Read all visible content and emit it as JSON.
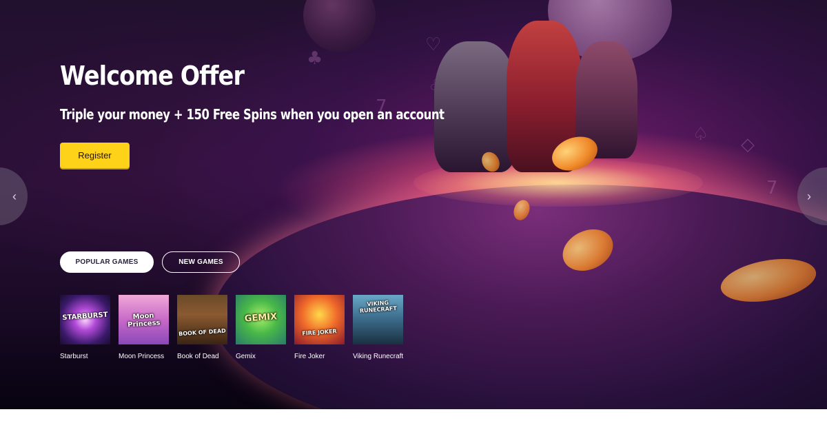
{
  "hero": {
    "title": "Welcome Offer",
    "subtitle": "Triple your money + 150 Free Spins when you open an account",
    "register_label": "Register",
    "carousel_prev_icon": "chevron-left-icon",
    "carousel_next_icon": "chevron-right-icon"
  },
  "tabs": [
    {
      "label": "POPULAR GAMES",
      "active": true
    },
    {
      "label": "NEW GAMES",
      "active": false
    }
  ],
  "games": [
    {
      "name": "Starburst",
      "thumb_text": "STARBURST"
    },
    {
      "name": "Moon Princess",
      "thumb_text": "Moon Princess"
    },
    {
      "name": "Book of Dead",
      "thumb_text": "BOOK OF DEAD"
    },
    {
      "name": "Gemix",
      "thumb_text": "GEMIX"
    },
    {
      "name": "Fire Joker",
      "thumb_text": "FIRE JOKER"
    },
    {
      "name": "Viking Runecraft",
      "thumb_text": "VIKING RUNECRAFT"
    }
  ],
  "colors": {
    "accent": "#ffd21a",
    "background": "#22102f"
  }
}
